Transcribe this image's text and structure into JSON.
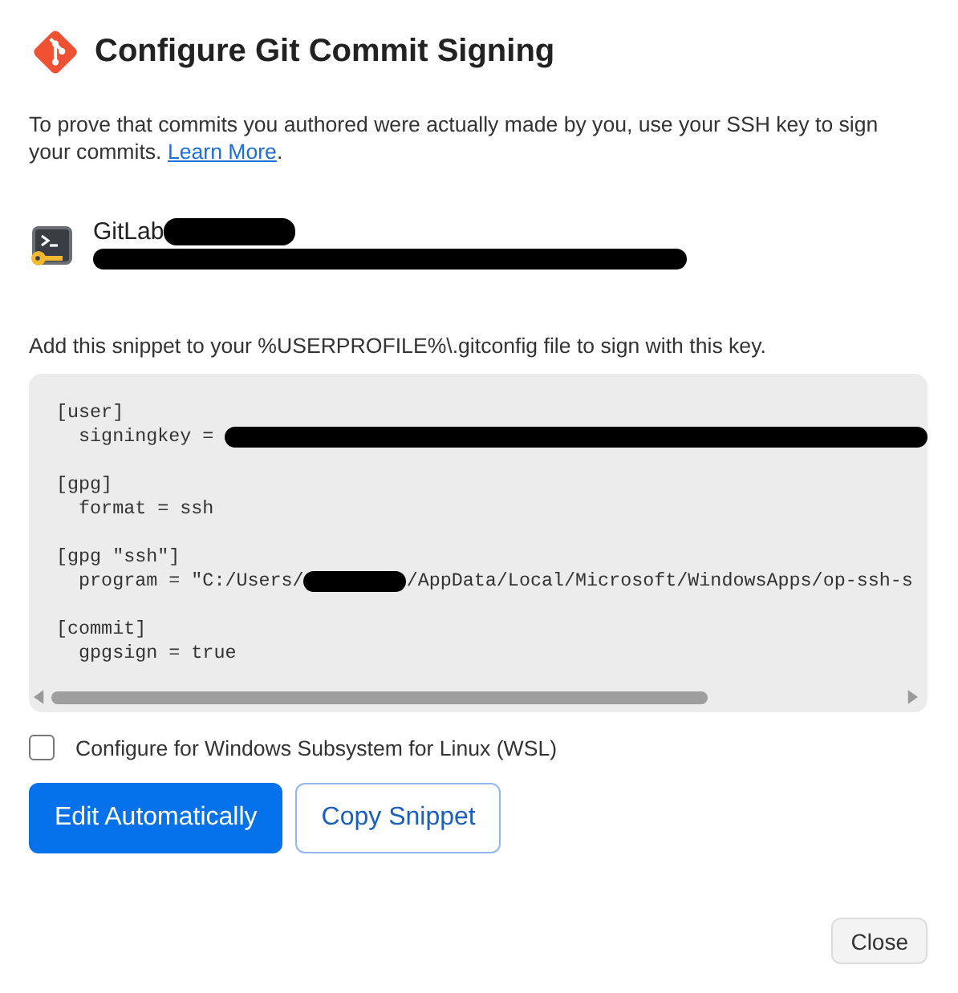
{
  "dialog": {
    "title": "Configure Git Commit Signing"
  },
  "intro": {
    "text": "To prove that commits you authored were actually made by you, use your SSH key to sign your commits.",
    "link": "Learn More",
    "after": "."
  },
  "key_item": {
    "name": "GitLab"
  },
  "instruction": "Add this snippet to your %USERPROFILE%\\.gitconfig file to sign with this key.",
  "snippet_sections": [
    {
      "header": "[user]",
      "line": "  signingkey = ",
      "masked": true
    },
    {
      "header": "[gpg]",
      "line": "  format = ssh"
    },
    {
      "header": "[gpg \"ssh\"]",
      "line": "  program = \"C:/Users/",
      "masked": true,
      "rest": "/AppData/Local/Microsoft/WindowsApps/op-ssh-s"
    },
    {
      "header": "[commit]",
      "line": "  gpgsign = true"
    }
  ],
  "wsl_option": {
    "label": "Configure for Windows Subsystem for Linux (WSL)",
    "checked": false
  },
  "actions": [
    {
      "label": "Edit Automatically",
      "kind": "primary"
    },
    {
      "label": "Copy Snippet",
      "kind": "secondary"
    }
  ],
  "close_button": "Close"
}
